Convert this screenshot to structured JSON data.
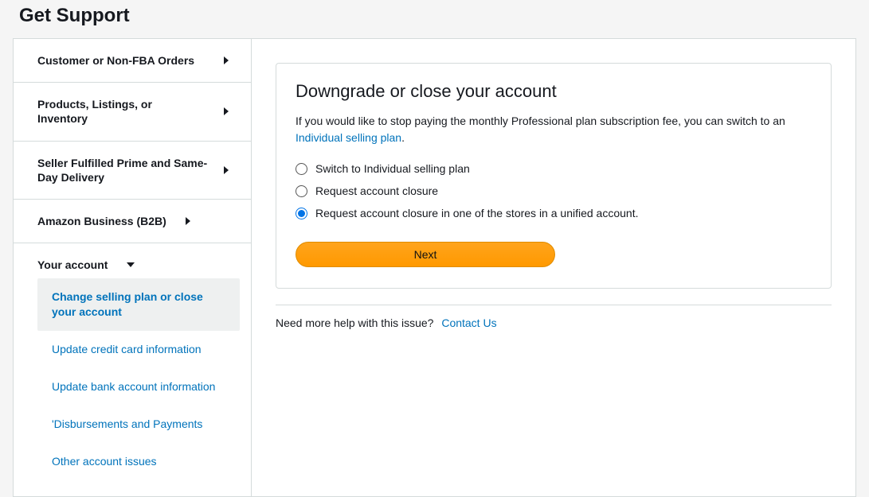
{
  "page_title": "Get Support",
  "sidebar": {
    "items": [
      {
        "label": "Customer or Non-FBA Orders",
        "expanded": false
      },
      {
        "label": "Products, Listings, or Inventory",
        "expanded": false
      },
      {
        "label": "Seller Fulfilled Prime and Same-Day Delivery",
        "expanded": false
      },
      {
        "label": "Amazon Business (B2B)",
        "expanded": false
      },
      {
        "label": "Your account",
        "expanded": true,
        "children": [
          {
            "label": "Change selling plan or close your account",
            "active": true
          },
          {
            "label": "Update credit card information",
            "active": false
          },
          {
            "label": "Update bank account information",
            "active": false
          },
          {
            "label": "'Disbursements and Payments",
            "active": false
          },
          {
            "label": "Other account issues",
            "active": false
          }
        ]
      }
    ]
  },
  "panel": {
    "heading": "Downgrade or close your account",
    "intro_pre": "If you would like to stop paying the monthly Professional plan subscription fee, you can switch to an ",
    "intro_link": "Individual selling plan",
    "intro_post": ".",
    "options": [
      {
        "label": "Switch to Individual selling plan",
        "checked": false
      },
      {
        "label": "Request account closure",
        "checked": false
      },
      {
        "label": "Request account closure in one of the stores in a unified account.",
        "checked": true
      }
    ],
    "next_label": "Next"
  },
  "help": {
    "text": "Need more help with this issue?",
    "link": "Contact Us"
  }
}
